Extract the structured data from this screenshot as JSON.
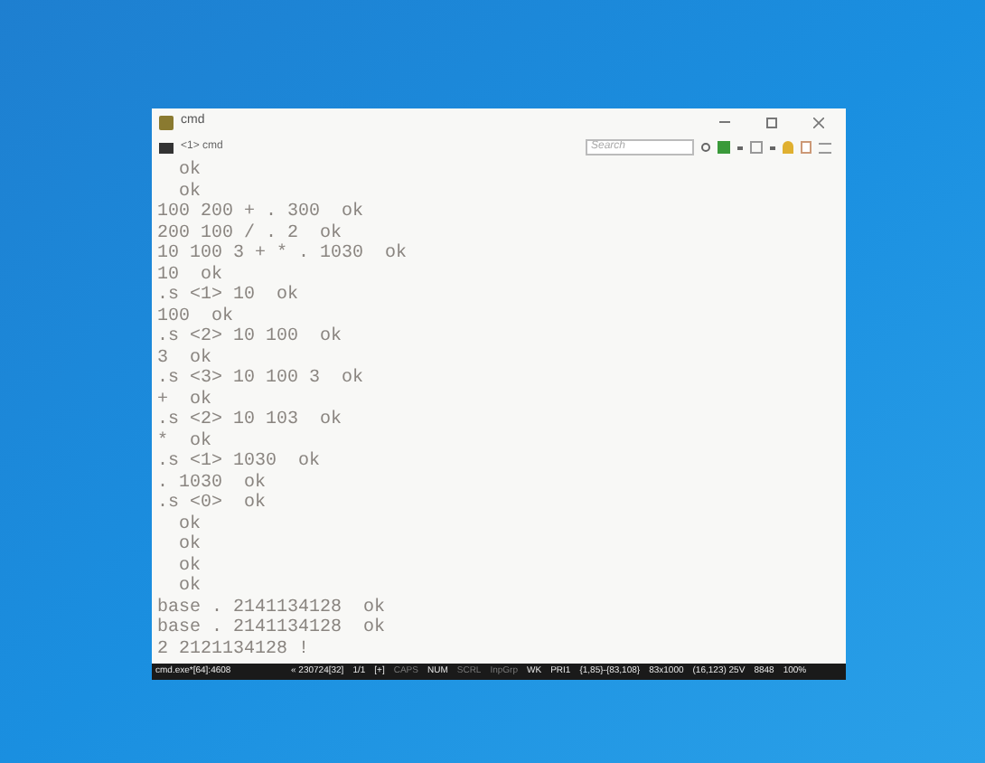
{
  "window": {
    "title": "cmd"
  },
  "tab": {
    "label": "<1> cmd"
  },
  "search": {
    "placeholder": "Search"
  },
  "console_lines": [
    "  ok",
    "  ok",
    "100 200 + . 300  ok",
    "200 100 / . 2  ok",
    "10 100 3 + * . 1030  ok",
    "10  ok",
    ".s <1> 10  ok",
    "100  ok",
    ".s <2> 10 100  ok",
    "3  ok",
    ".s <3> 10 100 3  ok",
    "+  ok",
    ".s <2> 10 103  ok",
    "*  ok",
    ".s <1> 1030  ok",
    ". 1030  ok",
    ".s <0>  ok",
    "  ok",
    "  ok",
    "  ok",
    "  ok",
    "base . 2141134128  ok",
    "base . 2141134128  ok",
    "2 2121134128 !"
  ],
  "status_bar": [
    {
      "text": "cmd.exe*[64]:4608",
      "on": true
    },
    {
      "text": "« 230724[32]",
      "on": true
    },
    {
      "text": "1/1",
      "on": true
    },
    {
      "text": "[+]",
      "on": true
    },
    {
      "text": "CAPS",
      "on": false
    },
    {
      "text": "NUM",
      "on": true
    },
    {
      "text": "SCRL",
      "on": false
    },
    {
      "text": "InpGrp",
      "on": false
    },
    {
      "text": "WK",
      "on": true
    },
    {
      "text": "PRI1",
      "on": true
    },
    {
      "text": "{1,85}-{83,108}",
      "on": true
    },
    {
      "text": "83x1000",
      "on": true
    },
    {
      "text": "(16,123) 25V",
      "on": true
    },
    {
      "text": "8848",
      "on": true
    },
    {
      "text": "100%",
      "on": true
    }
  ]
}
